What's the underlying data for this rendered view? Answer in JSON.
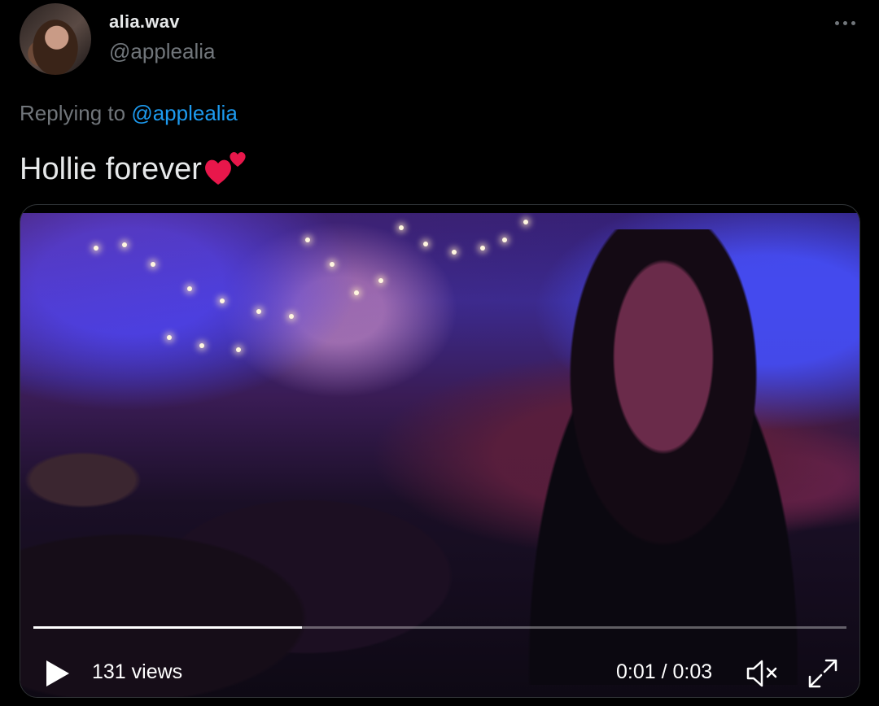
{
  "author": {
    "display_name": "alia.wav",
    "handle": "@applealia"
  },
  "reply": {
    "prefix": "Replying to",
    "mention": "@applealia"
  },
  "tweet": {
    "text": "Hollie forever"
  },
  "media": {
    "views": "131 views",
    "time": "0:01 / 0:03",
    "progress": 0.33
  },
  "icons": {
    "more": "more-icon",
    "hearts": "two-hearts-emoji",
    "play": "play-icon",
    "mute": "muted-speaker-icon",
    "fullscreen": "fullscreen-icon"
  },
  "colors": {
    "link": "#1d9bf0",
    "secondary_text": "#71767b",
    "heart": "#e8174b"
  }
}
